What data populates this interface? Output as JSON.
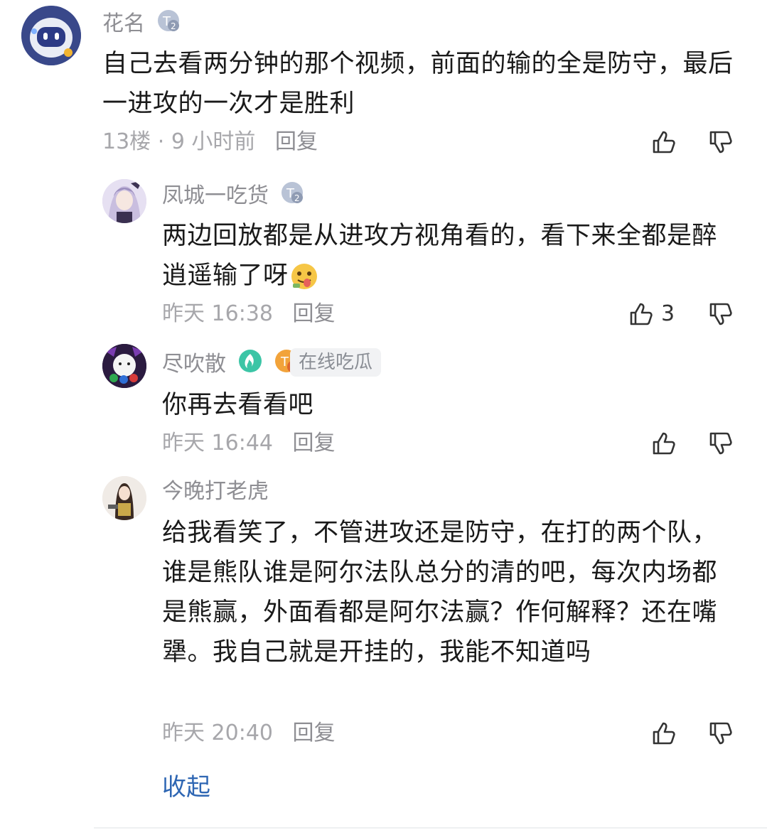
{
  "comments": [
    {
      "user": "花名",
      "level_badge": "2",
      "text": "自己去看两分钟的那个视频，前面的输的全是防守，最后一进攻的一次才是胜利",
      "floor": "13楼",
      "time": "9 小时前",
      "reply": "回复"
    },
    {
      "user": "凤城一吃货",
      "level_badge": "2",
      "text": "两边回放都是从进攻方视角看的，看下来全都是醉逍遥输了呀",
      "emoji": "face-with-tongue-emoji",
      "time": "昨天 16:38",
      "reply": "回复",
      "likes": "3"
    },
    {
      "user": "尽吹散",
      "level_badge": "8",
      "tag": "在线吃瓜",
      "text": "你再去看看吧",
      "time": "昨天 16:44",
      "reply": "回复"
    },
    {
      "user": "今晚打老虎",
      "text": "给我看笑了，不管进攻还是防守，在打的两个队，谁是熊队谁是阿尔法队总分的清的吧，每次内场都是熊赢，外面看都是阿尔法赢？作何解释？还在嘴犟。我自己就是开挂的，我能不知道吗",
      "time": "昨天 20:40",
      "reply": "回复"
    }
  ],
  "collapse_label": "收起",
  "colors": {
    "link": "#2e66b3",
    "meta": "#a7a7ab",
    "name": "#8e8e93"
  }
}
